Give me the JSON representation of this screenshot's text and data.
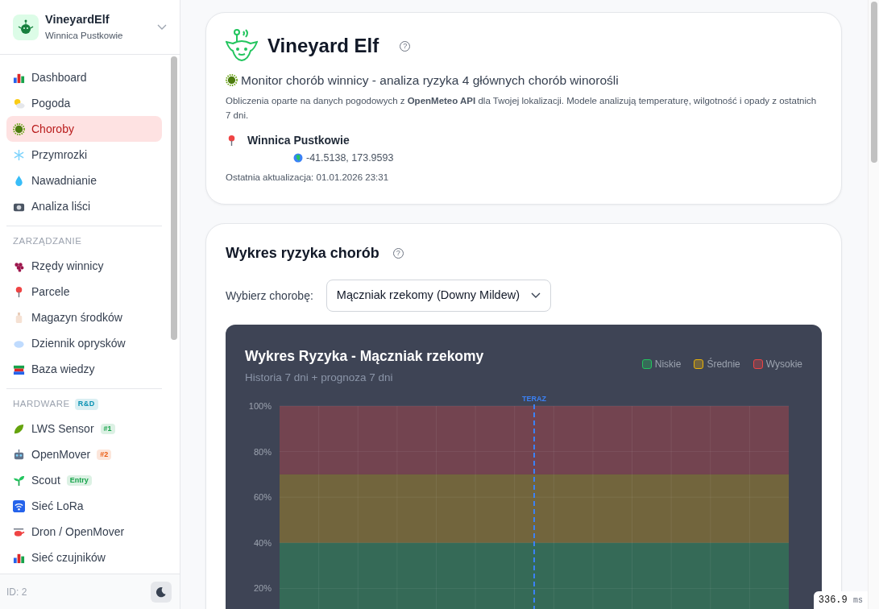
{
  "sidebar": {
    "brand": {
      "title": "VineyardElf",
      "subtitle": "Winnica Pustkowie"
    },
    "sections": [
      {
        "items": [
          {
            "label": "Dashboard",
            "selected": false
          },
          {
            "label": "Pogoda",
            "selected": false
          },
          {
            "label": "Choroby",
            "selected": true
          },
          {
            "label": "Przymrozki",
            "selected": false
          },
          {
            "label": "Nawadnianie",
            "selected": false
          },
          {
            "label": "Analiza liści",
            "selected": false
          }
        ]
      },
      {
        "heading": "ZARZĄDZANIE",
        "items": [
          {
            "label": "Rzędy winnicy",
            "selected": false
          },
          {
            "label": "Parcele",
            "selected": false
          },
          {
            "label": "Magazyn środków",
            "selected": false
          },
          {
            "label": "Dziennik oprysków",
            "selected": false
          },
          {
            "label": "Baza wiedzy",
            "selected": false
          }
        ]
      },
      {
        "heading": "HARDWARE",
        "heading_badge": {
          "text": "R&D",
          "color": "#0891b2"
        },
        "items": [
          {
            "label": "LWS Sensor",
            "selected": false,
            "badge": {
              "text": "#1",
              "color": "#16a34a"
            }
          },
          {
            "label": "OpenMover",
            "selected": false,
            "badge": {
              "text": "#2",
              "color": "#ea580c"
            }
          },
          {
            "label": "Scout",
            "selected": false,
            "badge": {
              "text": "Entry",
              "color": "#16a34a"
            }
          },
          {
            "label": "Sieć LoRa",
            "selected": false
          },
          {
            "label": "Dron / OpenMover",
            "selected": false
          },
          {
            "label": "Sieć czujników",
            "selected": false
          }
        ]
      }
    ],
    "footer": {
      "id_text": "ID: 2"
    }
  },
  "header_card": {
    "title": "Vineyard Elf",
    "help_mark": "?",
    "subtitle": "Monitor chorób winnicy - analiza ryzyka 4 głównych chorób winorośli",
    "description": "Obliczenia oparte na danych pogodowych z **OpenMeteo API** dla Twojej lokalizacji. Modele analizują temperaturę, wilgotność i opady z ostatnich 7 dni.",
    "location": "Winnica Pustkowie",
    "coordinates": "-41.5138, 173.9593",
    "updated": "Ostatnia aktualizacja: 01.01.2026 23:31"
  },
  "chart_card": {
    "title": "Wykres ryzyka chorób",
    "help_mark": "?",
    "select_label": "Wybierz chorobę:",
    "select_value": "Mączniak rzekomy (Downy Mildew)",
    "panel": {
      "title": "Wykres Ryzyka - Mączniak rzekomy",
      "subtitle": "Historia 7 dni + prognoza 7 dni",
      "legend": [
        {
          "label": "Niskie",
          "color": "#22c55e"
        },
        {
          "label": "Średnie",
          "color": "#eab308"
        },
        {
          "label": "Wysokie",
          "color": "#ef4444"
        }
      ],
      "axis_labels": [
        "100%",
        "80%",
        "60%",
        "40%",
        "20%"
      ],
      "now_label": "TERAZ"
    }
  },
  "timing": {
    "value": "336.9",
    "unit": "ms"
  }
}
